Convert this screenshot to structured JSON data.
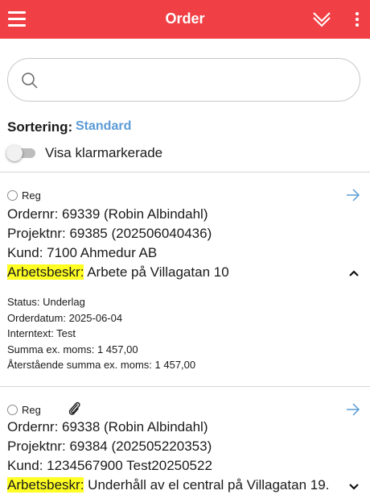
{
  "header": {
    "title": "Order",
    "menu_icon": "hamburger-menu-icon",
    "collapse_icon": "double-chevron-down-icon",
    "more_icon": "more-vertical-icon",
    "background_color": "#f04045"
  },
  "search": {
    "placeholder": "",
    "value": "",
    "icon": "search-icon"
  },
  "sorting": {
    "label": "Sortering:",
    "value": "Standard",
    "value_color": "#5b9bd5"
  },
  "show_completed": {
    "label": "Visa klarmarkerade",
    "enabled": false
  },
  "orders": [
    {
      "status_label": "Reg",
      "has_attachment": false,
      "expanded": true,
      "order_nr": "Ordernr: 69339 (Robin Albindahl)",
      "project_nr": "Projektnr: 69385 (202506040436)",
      "customer": "Kund: 7100 Ahmedur AB",
      "description_label": "Arbetsbeskr:",
      "description": " Arbete på Villagatan 10",
      "details": {
        "status": "Status: Underlag",
        "order_date": "Orderdatum: 2025-06-04",
        "internal_text": "Interntext: Test",
        "sum_ex_vat": "Summa ex. moms: 1 457,00",
        "remaining_sum_ex_vat": "Återstående summa ex. moms: 1 457,00"
      }
    },
    {
      "status_label": "Reg",
      "has_attachment": true,
      "expanded": false,
      "order_nr": "Ordernr: 69338 (Robin Albindahl)",
      "project_nr": "Projektnr: 69384 (202505220353)",
      "customer": "Kund: 1234567900 Test20250522",
      "description_label": "Arbetsbeskr:",
      "description": " Underhåll av el central på Villagatan 19."
    }
  ],
  "colors": {
    "highlight": "#ffff24",
    "link_arrow": "#5b9bd5"
  }
}
